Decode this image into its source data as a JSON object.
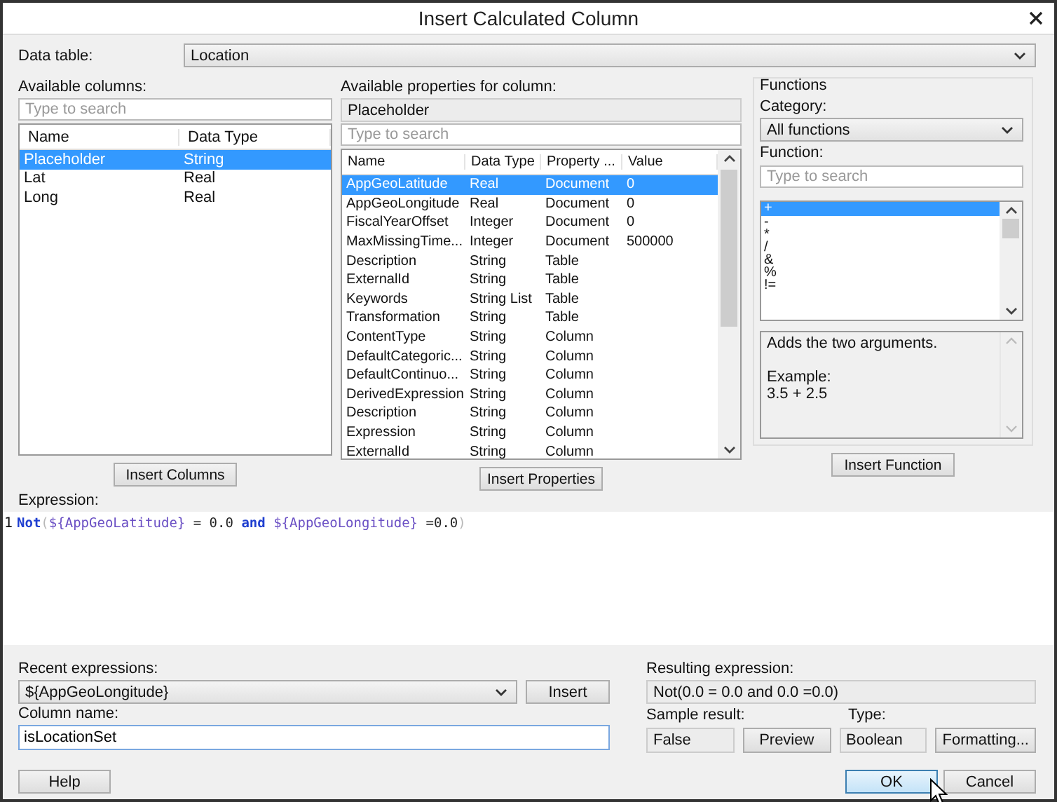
{
  "window": {
    "title": "Insert Calculated Column"
  },
  "data_table": {
    "label": "Data table:",
    "value": "Location"
  },
  "available_columns": {
    "label": "Available columns:",
    "search_placeholder": "Type to search",
    "columns": [
      "Name",
      "Data Type"
    ],
    "rows": [
      {
        "name": "Placeholder",
        "type": "String",
        "selected": true
      },
      {
        "name": "Lat",
        "type": "Real",
        "selected": false
      },
      {
        "name": "Long",
        "type": "Real",
        "selected": false
      }
    ],
    "button": "Insert Columns"
  },
  "available_properties": {
    "label": "Available properties for column:",
    "column": "Placeholder",
    "search_placeholder": "Type to search",
    "columns": [
      "Name",
      "Data Type",
      "Property ...",
      "Value"
    ],
    "rows": [
      {
        "cells": [
          "AppGeoLatitude",
          "Real",
          "Document",
          "0"
        ],
        "selected": true
      },
      {
        "cells": [
          "AppGeoLongitude",
          "Real",
          "Document",
          "0"
        ],
        "selected": false
      },
      {
        "cells": [
          "FiscalYearOffset",
          "Integer",
          "Document",
          "0"
        ],
        "selected": false
      },
      {
        "cells": [
          "MaxMissingTime...",
          "Integer",
          "Document",
          "500000"
        ],
        "selected": false
      },
      {
        "cells": [
          "Description",
          "String",
          "Table"
        ],
        "selected": false
      },
      {
        "cells": [
          "ExternalId",
          "String",
          "Table"
        ],
        "selected": false
      },
      {
        "cells": [
          "Keywords",
          "String List",
          "Table"
        ],
        "selected": false
      },
      {
        "cells": [
          "Transformation",
          "String",
          "Table"
        ],
        "selected": false
      },
      {
        "cells": [
          "ContentType",
          "String",
          "Column"
        ],
        "selected": false
      },
      {
        "cells": [
          "DefaultCategoric...",
          "String",
          "Column"
        ],
        "selected": false
      },
      {
        "cells": [
          "DefaultContinuo...",
          "String",
          "Column"
        ],
        "selected": false
      },
      {
        "cells": [
          "DerivedExpression",
          "String",
          "Column"
        ],
        "selected": false
      },
      {
        "cells": [
          "Description",
          "String",
          "Column"
        ],
        "selected": false
      },
      {
        "cells": [
          "Expression",
          "String",
          "Column"
        ],
        "selected": false
      },
      {
        "cells": [
          "ExternalId",
          "String",
          "Column"
        ],
        "selected": false
      }
    ],
    "button": "Insert Properties"
  },
  "functions": {
    "title": "Functions",
    "category_label": "Category:",
    "category": "All functions",
    "function_label": "Function:",
    "search_placeholder": "Type to search",
    "items": [
      {
        "text": "+",
        "selected": true
      },
      {
        "text": "-",
        "selected": false
      },
      {
        "text": "*",
        "selected": false
      },
      {
        "text": "/",
        "selected": false
      },
      {
        "text": "&",
        "selected": false
      },
      {
        "text": "%",
        "selected": false
      },
      {
        "text": "!=",
        "selected": false
      }
    ],
    "description": [
      "Adds the two arguments.",
      "Example:",
      "3.5 + 2.5"
    ],
    "button": "Insert Function"
  },
  "expression": {
    "label": "Expression:",
    "line_number": "1",
    "tokens": [
      {
        "kind": "keyword",
        "text": "Not"
      },
      {
        "kind": "paren",
        "text": "("
      },
      {
        "kind": "field",
        "text": "${AppGeoLatitude}"
      },
      {
        "kind": "plain",
        "text": " = 0.0 "
      },
      {
        "kind": "keyword",
        "text": "and"
      },
      {
        "kind": "field",
        "text": " ${AppGeoLongitude}"
      },
      {
        "kind": "plain",
        "text": " =0.0"
      },
      {
        "kind": "paren",
        "text": ")"
      }
    ]
  },
  "recent_expressions": {
    "label": "Recent expressions:",
    "value": "${AppGeoLongitude}",
    "button": "Insert"
  },
  "column_name": {
    "label": "Column name:",
    "value": "isLocationSet"
  },
  "resulting_expression": {
    "label": "Resulting expression:",
    "value": "Not(0.0 = 0.0 and 0.0 =0.0)"
  },
  "sample_result": {
    "label": "Sample result:",
    "value": "False",
    "button": "Preview"
  },
  "type": {
    "label": "Type:",
    "value": "Boolean",
    "button": "Formatting..."
  },
  "buttons": {
    "help": "Help",
    "ok": "OK",
    "cancel": "Cancel"
  }
}
